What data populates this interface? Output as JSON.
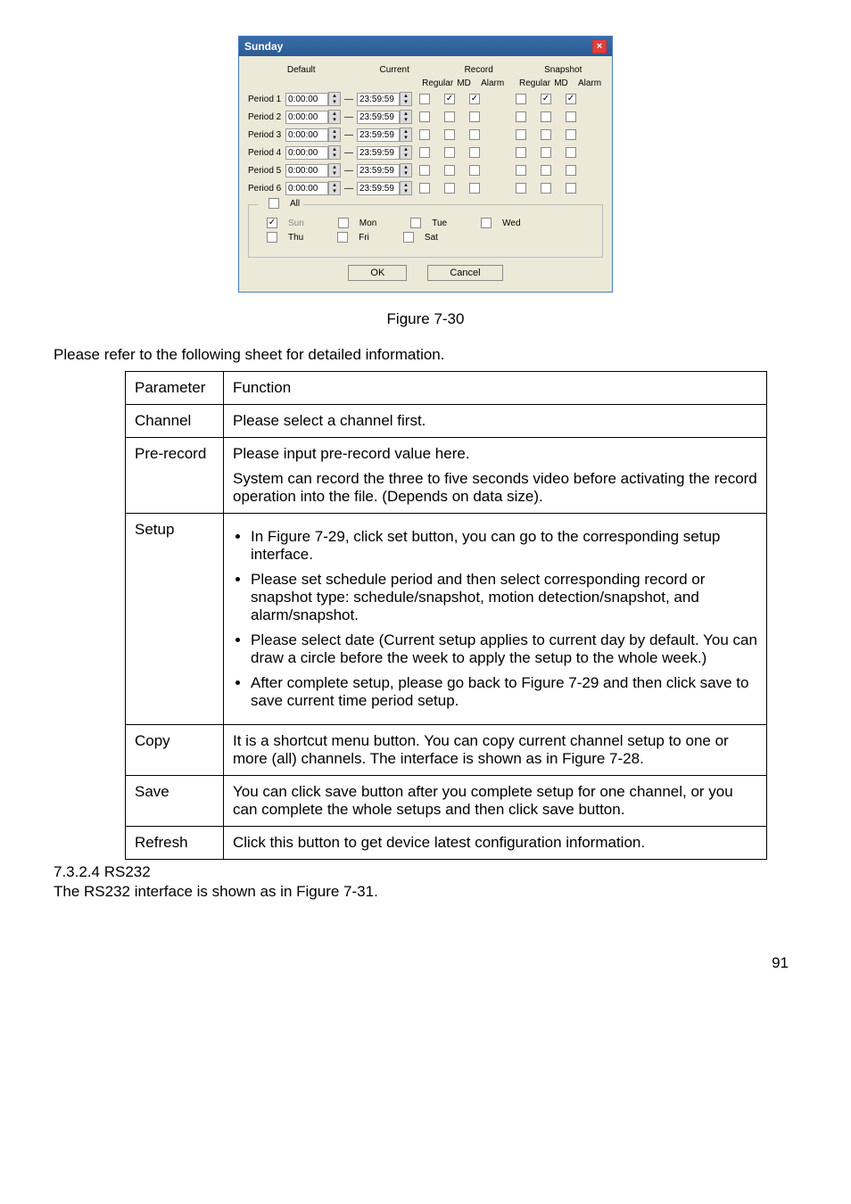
{
  "dialog": {
    "title": "Sunday",
    "headers": {
      "default": "Default",
      "current": "Current",
      "record": "Record",
      "snapshot": "Snapshot"
    },
    "subheaders": {
      "regular": "Regular",
      "md": "MD",
      "alarm": "Alarm"
    },
    "periods": [
      {
        "label": "Period 1",
        "from": "0:00:00",
        "to": "23:59:59",
        "rec": [
          false,
          true,
          true
        ],
        "snap": [
          false,
          true,
          true
        ]
      },
      {
        "label": "Period 2",
        "from": "0:00:00",
        "to": "23:59:59",
        "rec": [
          false,
          false,
          false
        ],
        "snap": [
          false,
          false,
          false
        ]
      },
      {
        "label": "Period 3",
        "from": "0:00:00",
        "to": "23:59:59",
        "rec": [
          false,
          false,
          false
        ],
        "snap": [
          false,
          false,
          false
        ]
      },
      {
        "label": "Period 4",
        "from": "0:00:00",
        "to": "23:59:59",
        "rec": [
          false,
          false,
          false
        ],
        "snap": [
          false,
          false,
          false
        ]
      },
      {
        "label": "Period 5",
        "from": "0:00:00",
        "to": "23:59:59",
        "rec": [
          false,
          false,
          false
        ],
        "snap": [
          false,
          false,
          false
        ]
      },
      {
        "label": "Period 6",
        "from": "0:00:00",
        "to": "23:59:59",
        "rec": [
          false,
          false,
          false
        ],
        "snap": [
          false,
          false,
          false
        ]
      }
    ],
    "all_label": "All",
    "days": {
      "sun": "Sun",
      "mon": "Mon",
      "tue": "Tue",
      "wed": "Wed",
      "thu": "Thu",
      "fri": "Fri",
      "sat": "Sat"
    },
    "day_checks": {
      "sun": true,
      "mon": false,
      "tue": false,
      "wed": false,
      "thu": false,
      "fri": false,
      "sat": false
    },
    "buttons": {
      "ok": "OK",
      "cancel": "Cancel"
    }
  },
  "figure_caption": "Figure 7-30",
  "lead_text": "Please refer to the following sheet for detailed information.",
  "table": {
    "head": {
      "param": "Parameter",
      "func": "Function"
    },
    "rows": {
      "channel": {
        "k": "Channel",
        "v": "Please select a channel first."
      },
      "prerecord": {
        "k": "Pre-record",
        "v1": "Please input pre-record value here.",
        "v2": "System can record the three to five seconds video before activating the record operation into the file. (Depends on data size)."
      },
      "setup": {
        "k": "Setup",
        "b1": "In Figure 7-29, click set button, you can go to the corresponding setup interface.",
        "b2": "Please set schedule period and then select corresponding record or snapshot type: schedule/snapshot, motion detection/snapshot, and alarm/snapshot.",
        "b3": "Please select date (Current setup applies to current day by default. You can draw a circle before the week to apply the setup to the whole week.)",
        "b4": "After complete setup, please go back to Figure 7-29 and then click save to save current time period setup."
      },
      "copy": {
        "k": "Copy",
        "v": "It is a shortcut menu button. You can copy current channel setup to one or more (all) channels.  The interface is shown as in Figure 7-28."
      },
      "save": {
        "k": "Save",
        "v": "You can click save button after you complete setup for one channel, or you can complete the whole setups and then click save button."
      },
      "refresh": {
        "k": "Refresh",
        "v": "Click this button to get device latest configuration information."
      }
    }
  },
  "section": {
    "num": "7.3.2.4  RS232",
    "text": "The RS232 interface is shown as in Figure 7-31."
  },
  "page_number": "91"
}
